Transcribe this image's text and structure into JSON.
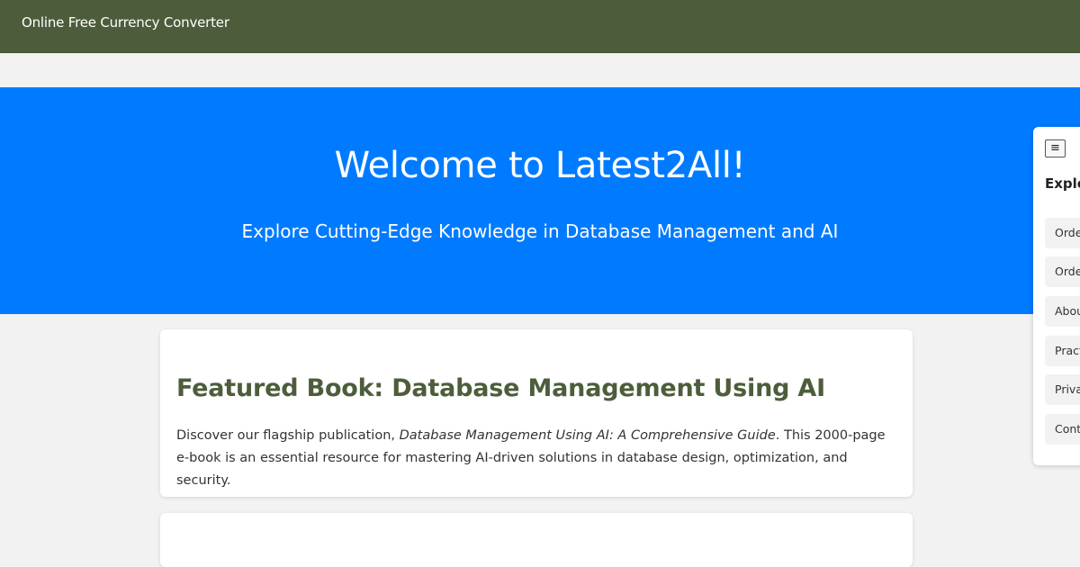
{
  "topbar": {
    "brand": "Online Free Currency Converter"
  },
  "hero": {
    "title": "Welcome to Latest2All!",
    "subtitle": "Explore Cutting-Edge Knowledge in Database Management and AI"
  },
  "featured": {
    "title": "Featured Book: Database Management Using AI",
    "desc_before": "Discover our flagship publication, ",
    "desc_italic": "Database Management Using AI: A Comprehensive Guide",
    "desc_after": ". This 2000-page e-book is an essential resource for mastering AI-driven solutions in database design, optimization, and security."
  },
  "sidepanel": {
    "toggle_icon": "≡",
    "heading": "Explo",
    "links": [
      "Orde",
      "Orde",
      "Abou",
      "Pract",
      "Priva",
      "Conta"
    ]
  }
}
